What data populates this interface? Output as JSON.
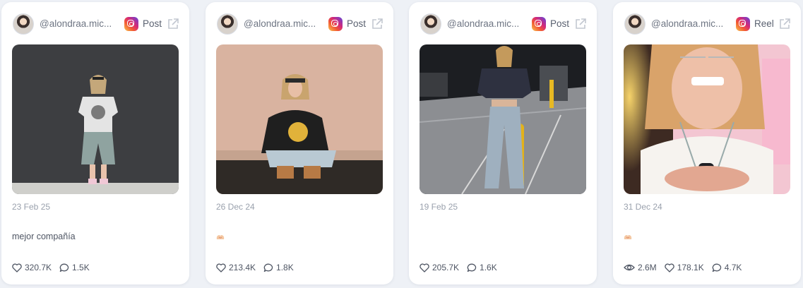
{
  "cards": [
    {
      "handle": "@alondraa.mic...",
      "platform_icon": "instagram-icon",
      "type": "Post",
      "date": "23 Feb 25",
      "caption": "mejor compañía",
      "likes": "320.7K",
      "comments": "1.5K"
    },
    {
      "handle": "@alondraa.mic...",
      "platform_icon": "instagram-icon",
      "type": "Post",
      "date": "26 Dec 24",
      "caption_emoji": "heart-hands-emoji",
      "likes": "213.4K",
      "comments": "1.8K"
    },
    {
      "handle": "@alondraa.mic...",
      "platform_icon": "instagram-icon",
      "type": "Post",
      "date": "19 Feb 25",
      "likes": "205.7K",
      "comments": "1.6K"
    },
    {
      "handle": "@alondraa.mic...",
      "platform_icon": "instagram-icon",
      "type": "Reel",
      "date": "31 Dec 24",
      "caption_emoji": "heart-hands-emoji",
      "views": "2.6M",
      "likes": "178.1K",
      "comments": "4.7K"
    }
  ],
  "colors": {
    "card_bg": "#ffffff",
    "page_bg": "#eef1f6",
    "muted_text": "#9aa1ad",
    "body_text": "#4e5563"
  }
}
